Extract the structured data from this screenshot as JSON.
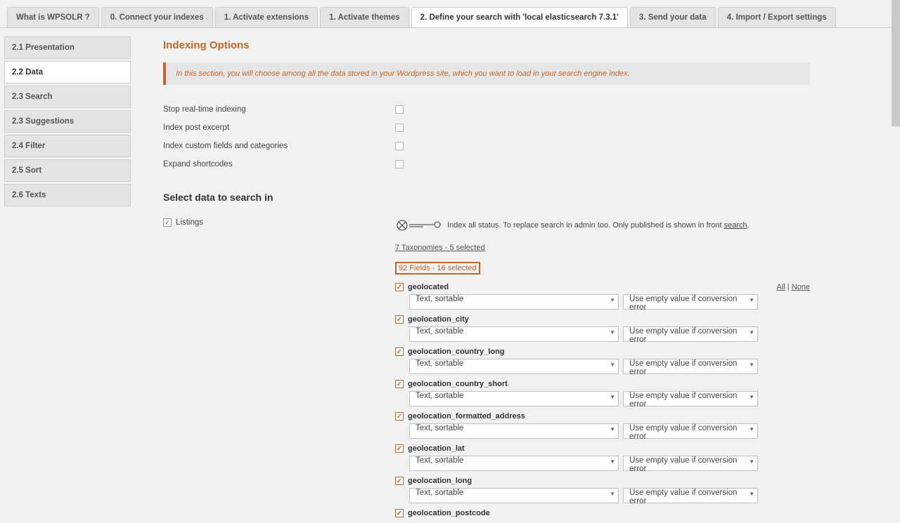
{
  "tabs": [
    {
      "label": "What is WPSOLR ?"
    },
    {
      "label": "0. Connect your indexes"
    },
    {
      "label": "1. Activate extensions"
    },
    {
      "label": "1. Activate themes"
    },
    {
      "label": "2. Define your search with 'local elasticsearch 7.3.1'"
    },
    {
      "label": "3. Send your data"
    },
    {
      "label": "4. Import / Export settings"
    }
  ],
  "side": [
    {
      "label": "2.1 Presentation"
    },
    {
      "label": "2.2 Data"
    },
    {
      "label": "2.3 Search"
    },
    {
      "label": "2.3 Suggestions"
    },
    {
      "label": "2.4 Filter"
    },
    {
      "label": "2.5 Sort"
    },
    {
      "label": "2.6 Texts"
    }
  ],
  "page_title": "Indexing Options",
  "notice": "In this section, you will choose among all the data stored in your Wordpress site, which you want to load in your search engine index.",
  "options": {
    "stop": "Stop real-time indexing",
    "excerpt": "Index post excerpt",
    "custom": "Index custom fields and categories",
    "shortcodes": "Expand shortcodes"
  },
  "section_title": "Select data to search in",
  "listings_label": "Listings",
  "index_status_pre": "Index all status. To replace search in admin too. Only published is shown in front ",
  "index_status_link": "search",
  "index_status_post": ".",
  "tax_link": "7 Taxonomies - 5 selected",
  "fields_link": "92 Fields - 16 selected",
  "all_label": "All",
  "none_label": "None",
  "sep": " | ",
  "sel_text": "Text, sortable",
  "sel_empty": "Use empty value if conversion error",
  "fields": [
    {
      "name": "geolocated"
    },
    {
      "name": "geolocation_city"
    },
    {
      "name": "geolocation_country_long"
    },
    {
      "name": "geolocation_country_short"
    },
    {
      "name": "geolocation_formatted_address"
    },
    {
      "name": "geolocation_lat"
    },
    {
      "name": "geolocation_long"
    },
    {
      "name": "geolocation_postcode"
    }
  ]
}
